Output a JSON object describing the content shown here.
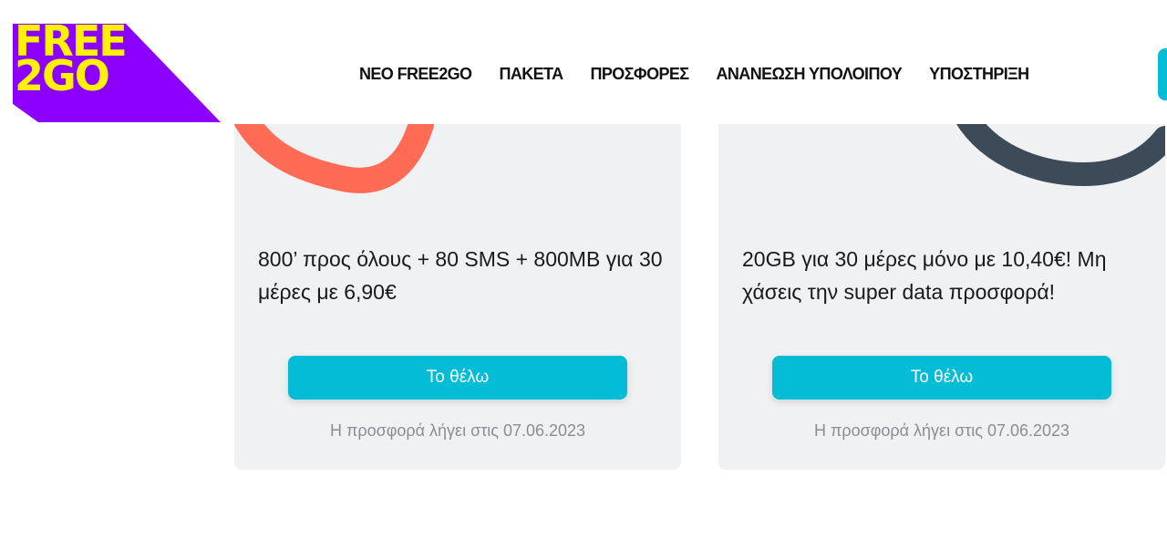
{
  "header": {
    "logo_line1": "FREE",
    "logo_line2": "2GO",
    "nav": [
      {
        "label": "ΝΕΟ FREE2GO"
      },
      {
        "label": "ΠΑΚΕΤΑ"
      },
      {
        "label": "ΠΡΟΣΦΟΡΕΣ"
      },
      {
        "label": "ΑΝΑΝΕΩΣΗ ΥΠΟΛΟΙΠΟΥ"
      },
      {
        "label": "ΥΠΟΣΤΗΡΙΞΗ"
      }
    ]
  },
  "offers": [
    {
      "description": "800’ προς όλους + 80 SMS + 800MB για 30 μέρες με 6,90€",
      "button_label": "Το θέλω",
      "expiry": "Η προσφορά λήγει στις 07.06.2023",
      "decoration_color": "#ff6b55"
    },
    {
      "description": "20GB για 30 μέρες μόνο με 10,40€! Μη χάσεις την super data προσφορά!",
      "button_label": "Το θέλω",
      "expiry": "Η προσφορά λήγει στις 07.06.2023",
      "decoration_color": "#3d4b59"
    }
  ],
  "colors": {
    "logo_purple": "#8b00ff",
    "logo_yellow": "#fff200",
    "accent_cyan": "#03bcd6",
    "card_bg": "#f0f1f3"
  }
}
